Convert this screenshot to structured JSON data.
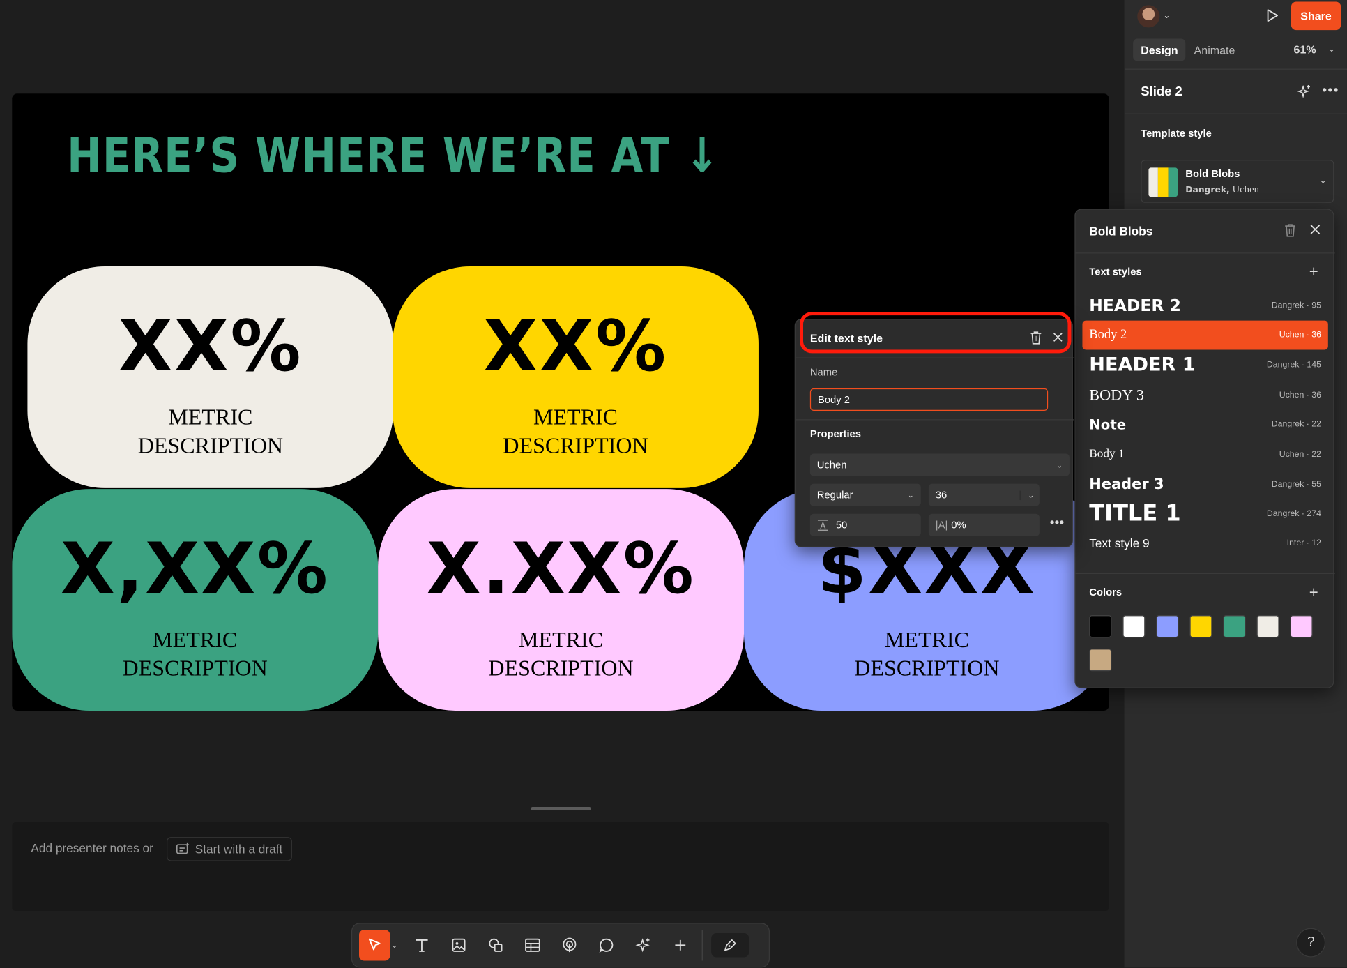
{
  "slide": {
    "title": "HERE’S WHERE WE’RE AT ↓",
    "cards": [
      {
        "value": "XX%",
        "desc": "METRIC DESCRIPTION",
        "color": "#f0ede6"
      },
      {
        "value": "XX%",
        "desc": "METRIC DESCRIPTION",
        "color": "#ffd600"
      },
      {
        "value": "X,XX%",
        "desc": "METRIC DESCRIPTION",
        "color": "#3ba281"
      },
      {
        "value": "X.XX%",
        "desc": "METRIC DESCRIPTION",
        "color": "#ffc9ff"
      },
      {
        "value": "$XXX",
        "desc": "METRIC DESCRIPTION",
        "color": "#8c9dff"
      }
    ]
  },
  "notes": {
    "placeholder": "Add presenter notes or",
    "draft_label": "Start with a draft"
  },
  "toolbar": {
    "tools": [
      "move-tool-icon",
      "text-tool-icon",
      "image-tool-icon",
      "shape-tool-icon",
      "table-tool-icon",
      "interaction-tool-icon",
      "comment-tool-icon",
      "ai-tool-icon",
      "add-tool-icon"
    ]
  },
  "sidebar": {
    "share_label": "Share",
    "tab_design": "Design",
    "tab_animate": "Animate",
    "zoom": "61%",
    "slide_name": "Slide 2",
    "template_label": "Template style",
    "template_name": "Bold Blobs",
    "template_font_1": "Dangrek,",
    "template_font_2": " Uchen",
    "help": "?"
  },
  "blobs": {
    "title": "Bold Blobs",
    "text_styles_label": "Text styles",
    "text_styles": [
      {
        "name": "HEADER 2",
        "meta": "Dangrek · 95",
        "font": "dangrek",
        "size": 19,
        "selected": false
      },
      {
        "name": "Body 2",
        "meta": "Uchen · 36",
        "font": "uchen",
        "size": 15,
        "selected": true
      },
      {
        "name": "HEADER 1",
        "meta": "Dangrek · 145",
        "font": "dangrek",
        "size": 22,
        "selected": false
      },
      {
        "name": "BODY 3",
        "meta": "Uchen · 36",
        "font": "uchen",
        "size": 18,
        "selected": false
      },
      {
        "name": "Note",
        "meta": "Dangrek · 22",
        "font": "dangrek",
        "size": 16,
        "selected": false
      },
      {
        "name": "Body 1",
        "meta": "Uchen · 22",
        "font": "uchen",
        "size": 14,
        "selected": false
      },
      {
        "name": "Header 3",
        "meta": "Dangrek · 55",
        "font": "dangrek",
        "size": 17,
        "selected": false
      },
      {
        "name": "TITLE 1",
        "meta": "Dangrek · 274",
        "font": "dangrek",
        "size": 26,
        "selected": false
      },
      {
        "name": "Text style 9",
        "meta": "Inter · 12",
        "font": "inter",
        "size": 14,
        "selected": false
      }
    ],
    "colors_label": "Colors",
    "colors": [
      "#000000",
      "#ffffff",
      "#8c9dff",
      "#ffd600",
      "#3ba281",
      "#f0ede6",
      "#ffc9ff",
      "#c7a982"
    ]
  },
  "edit_style": {
    "title": "Edit text style",
    "name_label": "Name",
    "name_value": "Body 2",
    "properties_label": "Properties",
    "font_family": "Uchen",
    "font_weight": "Regular",
    "font_size": "36",
    "line_height": "50",
    "letter_spacing": "0%"
  }
}
